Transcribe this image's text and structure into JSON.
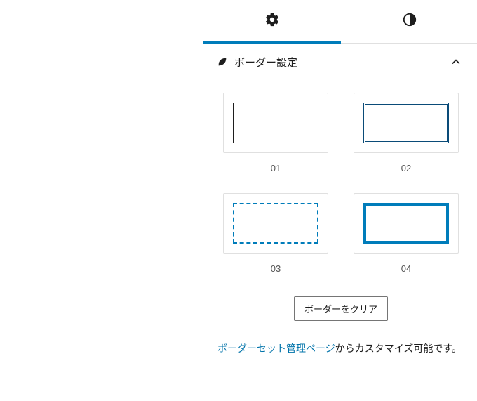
{
  "section": {
    "title": "ボーダー設定"
  },
  "options": [
    {
      "label": "01"
    },
    {
      "label": "02"
    },
    {
      "label": "03"
    },
    {
      "label": "04"
    }
  ],
  "clear_button": "ボーダーをクリア",
  "help": {
    "link_text": "ボーダーセット管理ページ",
    "after_text": "からカスタマイズ可能です。"
  }
}
